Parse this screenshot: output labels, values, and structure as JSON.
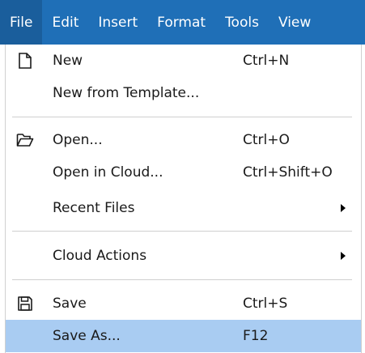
{
  "menubar": {
    "items": [
      {
        "label": "File"
      },
      {
        "label": "Edit"
      },
      {
        "label": "Insert"
      },
      {
        "label": "Format"
      },
      {
        "label": "Tools"
      },
      {
        "label": "View"
      }
    ]
  },
  "file_menu": {
    "new": {
      "label": "New",
      "shortcut": "Ctrl+N",
      "icon": "new-document-icon"
    },
    "new_from_template": {
      "label": "New from Template..."
    },
    "open": {
      "label": "Open...",
      "shortcut": "Ctrl+O",
      "icon": "folder-open-icon"
    },
    "open_in_cloud": {
      "label": "Open in Cloud...",
      "shortcut": "Ctrl+Shift+O"
    },
    "recent_files": {
      "label": "Recent Files",
      "icon": "submenu-arrow-icon"
    },
    "cloud_actions": {
      "label": "Cloud Actions",
      "icon": "submenu-arrow-icon"
    },
    "save": {
      "label": "Save",
      "shortcut": "Ctrl+S",
      "icon": "save-icon"
    },
    "save_as": {
      "label": "Save As...",
      "shortcut": "F12"
    }
  },
  "colors": {
    "menubar_bg": "#1f6fb7",
    "menubar_active_bg": "#1a5e9c",
    "highlight_bg": "#a9ccf2"
  }
}
